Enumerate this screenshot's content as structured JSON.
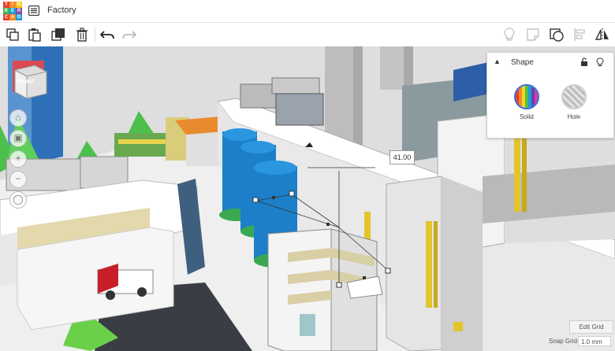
{
  "app": {
    "logo_letters": [
      "T",
      "I",
      "N",
      "K",
      "E",
      "R",
      "C",
      "A",
      "D"
    ],
    "logo_colors": [
      "#e8412f",
      "#f28a23",
      "#f7c61b",
      "#3fb54a",
      "#1f9bd7",
      "#7a4fa3",
      "#e8412f",
      "#f28a23",
      "#1f9bd7"
    ],
    "design_title": "Factory"
  },
  "toolbar": {
    "icons": [
      "copy-icon",
      "paste-icon",
      "duplicate-icon",
      "trash-icon",
      "undo-icon",
      "redo-icon",
      "light-icon",
      "note-icon",
      "group-icon",
      "align-icon",
      "mirror-icon"
    ]
  },
  "viewcube": {
    "face_label": "FRONT"
  },
  "dimension": {
    "value": "41.00"
  },
  "shape_panel": {
    "title": "Shape",
    "solid_label": "Solid",
    "hole_label": "Hole"
  },
  "grid": {
    "edit_label": "Edit Grid",
    "snap_label": "Snap Grid",
    "snap_value": "1.0 mm"
  },
  "colors": {
    "accent": "#3a6ad4",
    "tank_blue": "#1c7fc9",
    "pipe_yellow": "#e3c52b",
    "tower_blue": "#2e70b8",
    "building_orange": "#e98a2e",
    "cone_green": "#4cc04c",
    "van_red": "#c8202a"
  }
}
